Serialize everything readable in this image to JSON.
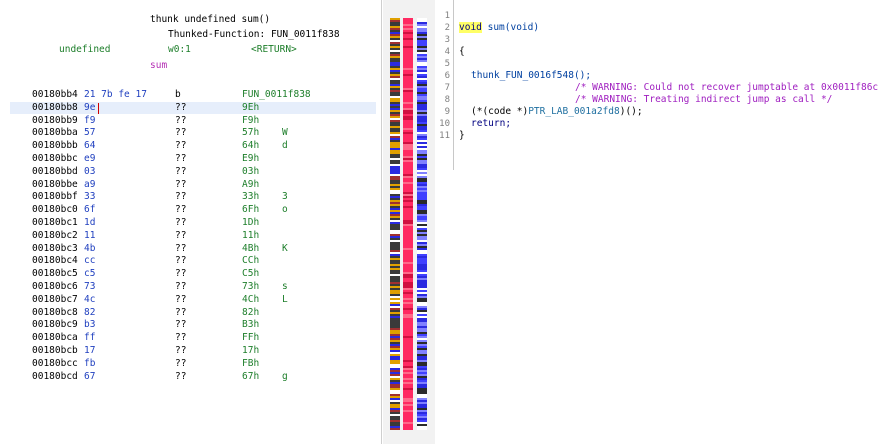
{
  "listing": {
    "header": {
      "signature": "thunk undefined sum()",
      "thunked": "Thunked-Function: FUN_0011f838",
      "ret_type": "undefined",
      "storage": "w0:1",
      "ret_label": "<RETURN>",
      "name": "sum"
    },
    "rows": [
      {
        "addr": "00180bb4",
        "bytes": "21 7b fe 17",
        "mnem": "b",
        "oper": "FUN_0011f838",
        "char": ""
      },
      {
        "addr": "00180bb8",
        "bytes": "9e",
        "mnem": "??",
        "oper": "9Eh",
        "char": ""
      },
      {
        "addr": "00180bb9",
        "bytes": "f9",
        "mnem": "??",
        "oper": "F9h",
        "char": ""
      },
      {
        "addr": "00180bba",
        "bytes": "57",
        "mnem": "??",
        "oper": "57h",
        "char": "W"
      },
      {
        "addr": "00180bbb",
        "bytes": "64",
        "mnem": "??",
        "oper": "64h",
        "char": "d"
      },
      {
        "addr": "00180bbc",
        "bytes": "e9",
        "mnem": "??",
        "oper": "E9h",
        "char": ""
      },
      {
        "addr": "00180bbd",
        "bytes": "03",
        "mnem": "??",
        "oper": "03h",
        "char": ""
      },
      {
        "addr": "00180bbe",
        "bytes": "a9",
        "mnem": "??",
        "oper": "A9h",
        "char": ""
      },
      {
        "addr": "00180bbf",
        "bytes": "33",
        "mnem": "??",
        "oper": "33h",
        "char": "3"
      },
      {
        "addr": "00180bc0",
        "bytes": "6f",
        "mnem": "??",
        "oper": "6Fh",
        "char": "o"
      },
      {
        "addr": "00180bc1",
        "bytes": "1d",
        "mnem": "??",
        "oper": "1Dh",
        "char": ""
      },
      {
        "addr": "00180bc2",
        "bytes": "11",
        "mnem": "??",
        "oper": "11h",
        "char": ""
      },
      {
        "addr": "00180bc3",
        "bytes": "4b",
        "mnem": "??",
        "oper": "4Bh",
        "char": "K"
      },
      {
        "addr": "00180bc4",
        "bytes": "cc",
        "mnem": "??",
        "oper": "CCh",
        "char": ""
      },
      {
        "addr": "00180bc5",
        "bytes": "c5",
        "mnem": "??",
        "oper": "C5h",
        "char": ""
      },
      {
        "addr": "00180bc6",
        "bytes": "73",
        "mnem": "??",
        "oper": "73h",
        "char": "s"
      },
      {
        "addr": "00180bc7",
        "bytes": "4c",
        "mnem": "??",
        "oper": "4Ch",
        "char": "L"
      },
      {
        "addr": "00180bc8",
        "bytes": "82",
        "mnem": "??",
        "oper": "82h",
        "char": ""
      },
      {
        "addr": "00180bc9",
        "bytes": "b3",
        "mnem": "??",
        "oper": "B3h",
        "char": ""
      },
      {
        "addr": "00180bca",
        "bytes": "ff",
        "mnem": "??",
        "oper": "FFh",
        "char": ""
      },
      {
        "addr": "00180bcb",
        "bytes": "17",
        "mnem": "??",
        "oper": "17h",
        "char": ""
      },
      {
        "addr": "00180bcc",
        "bytes": "fb",
        "mnem": "??",
        "oper": "FBh",
        "char": ""
      },
      {
        "addr": "00180bcd",
        "bytes": "67",
        "mnem": "??",
        "oper": "67h",
        "char": "g"
      }
    ]
  },
  "decompiler": {
    "line_numbers": [
      "1",
      "2",
      "3",
      "4",
      "5",
      "6",
      "7",
      "8",
      "9",
      "10",
      "11"
    ],
    "sig_type": "void",
    "sig_rest": " sum(void)",
    "open_brace": "{",
    "call": "thunk_FUN_0016f548();",
    "warn1": "/* WARNING: Could not recover jumptable at 0x0011f86c",
    "warn2": "/* WARNING: Treating indirect jump as call */",
    "call2_pre": "(*(code *)",
    "call2_label": "PTR_LAB_001a2fd8",
    "call2_post": ")();",
    "ret": "return;",
    "close_brace": "}"
  },
  "colors": {
    "strip_red": "#ff2a62",
    "strip_blue": "#2a2ae0",
    "strip_black": "#2a2a2a",
    "highlight_yellow": "#ffff66",
    "comment_magenta": "#a020c0"
  }
}
